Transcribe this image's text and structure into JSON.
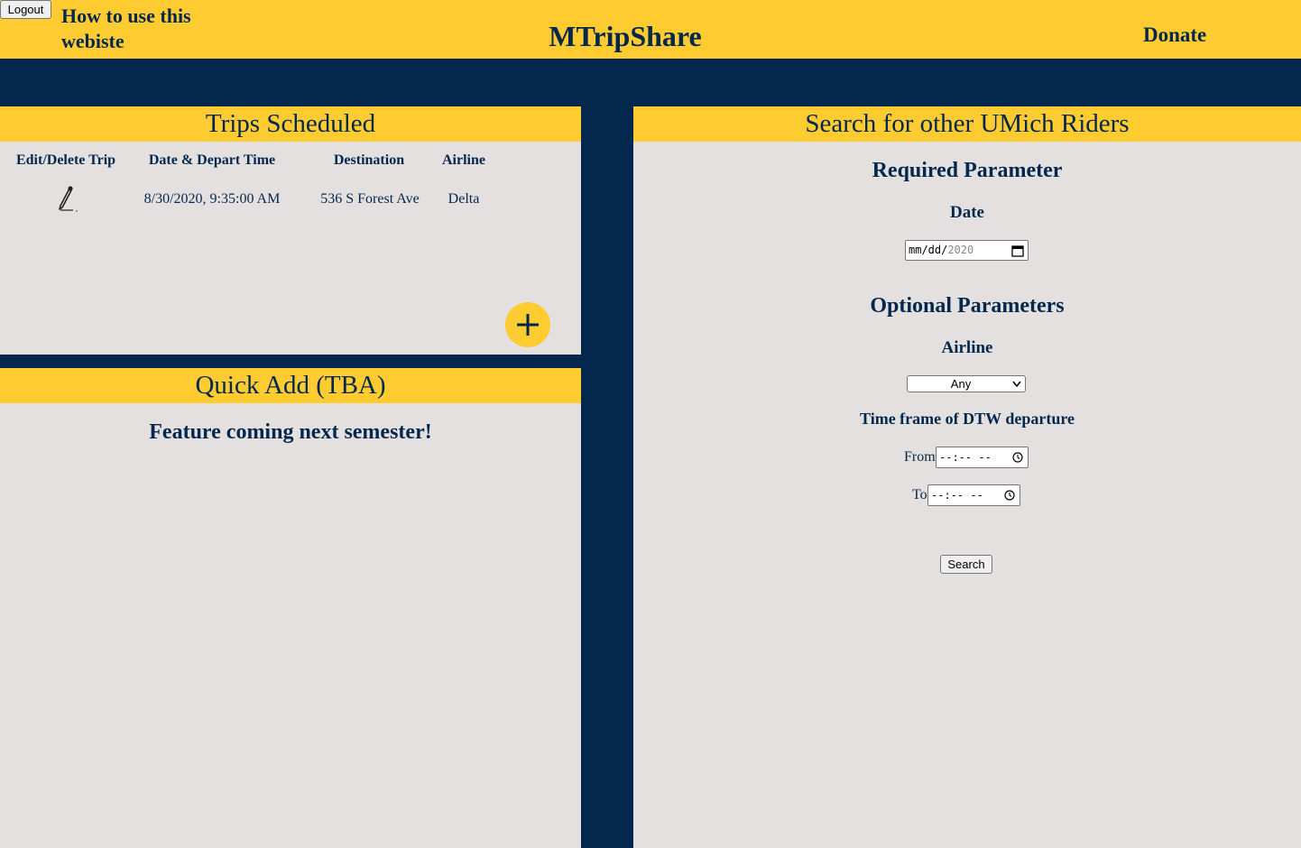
{
  "header": {
    "logout_label": "Logout",
    "howto_label": "How to use this webiste",
    "title": "MTripShare",
    "donate_label": "Donate"
  },
  "trips": {
    "heading": "Trips Scheduled",
    "columns": [
      "Edit/Delete Trip",
      "Date & Depart Time",
      "Destination",
      "Airline"
    ],
    "rows": [
      {
        "edit_icon": "pencil-icon",
        "datetime": "8/30/2020, 9:35:00 AM",
        "destination": "536 S Forest Ave",
        "airline": "Delta"
      }
    ],
    "add_icon": "plus-icon"
  },
  "quick_add": {
    "heading": "Quick Add (TBA)",
    "message": "Feature coming next semester!"
  },
  "search": {
    "heading": "Search for other UMich Riders",
    "required_heading": "Required Parameter",
    "date_label": "Date",
    "date_value_prefix": "mm/dd/",
    "date_value_year": "2020",
    "optional_heading": "Optional Parameters",
    "airline_label": "Airline",
    "airline_selected": "Any",
    "timeframe_label": "Time frame of DTW departure",
    "from_label": "From",
    "from_value": "--:-- --",
    "to_label": "To",
    "to_value": "--:-- --",
    "search_button": "Search"
  },
  "colors": {
    "maize": "#fecb30",
    "blue": "#04284d",
    "panel_bg": "#e4e0df"
  }
}
